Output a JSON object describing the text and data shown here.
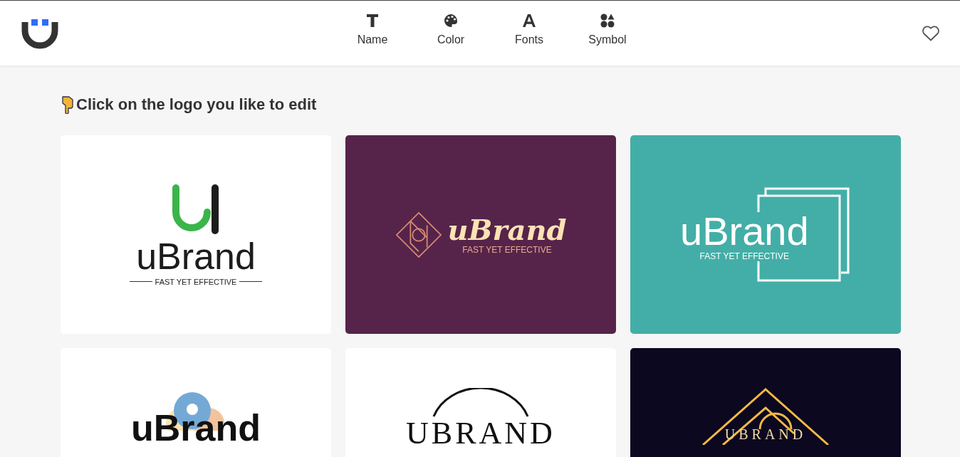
{
  "nav": [
    {
      "kind": "name",
      "label": "Name"
    },
    {
      "kind": "color",
      "label": "Color"
    },
    {
      "kind": "fonts",
      "label": "Fonts"
    },
    {
      "kind": "symbol",
      "label": "Symbol"
    }
  ],
  "heading": "Click on the logo you like to edit",
  "logos": [
    {
      "kind": "u-mark",
      "color": "#ffffff",
      "name": "uBrand",
      "tagline": "FAST YET EFFECTIVE"
    },
    {
      "kind": "diamond",
      "color": "#56244a",
      "name": "uBrand",
      "tagline": "FAST YET EFFECTIVE"
    },
    {
      "kind": "squares",
      "color": "#43aea7",
      "name": "uBrand",
      "tagline": "FAST YET EFFECTIVE"
    },
    {
      "kind": "circles",
      "color": "#ffffff",
      "name": "uBrand"
    },
    {
      "kind": "arc",
      "color": "#ffffff",
      "name": "UBRAND"
    },
    {
      "kind": "roof",
      "color": "#0b0820",
      "name": "UBRAND"
    }
  ]
}
